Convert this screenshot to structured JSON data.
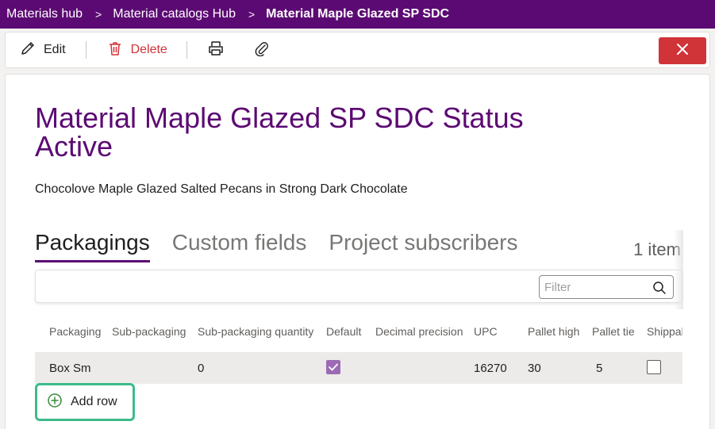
{
  "breadcrumb": {
    "items": [
      "Materials hub",
      "Material catalogs Hub",
      "Material Maple Glazed SP SDC"
    ],
    "separator": ">"
  },
  "toolbar": {
    "edit_label": "Edit",
    "delete_label": "Delete"
  },
  "header": {
    "title": "Material Maple Glazed SP SDC Status Active",
    "subtitle": "Chocolove Maple Glazed Salted Pecans in Strong Dark Chocolate"
  },
  "tabs": [
    {
      "label": "Packagings",
      "active": true
    },
    {
      "label": "Custom fields",
      "active": false
    },
    {
      "label": "Project subscribers",
      "active": false
    }
  ],
  "item_count": "1 item",
  "filter": {
    "placeholder": "Filter",
    "value": ""
  },
  "table": {
    "columns": [
      "Packaging",
      "Sub-packaging",
      "Sub-packaging quantity",
      "Default",
      "Decimal precision",
      "UPC",
      "Pallet high",
      "Pallet tie",
      "Shippable"
    ],
    "rows": [
      {
        "packaging": "Box Sm",
        "sub_packaging": "",
        "sub_packaging_quantity": "0",
        "default": true,
        "decimal_precision": "",
        "upc": "16270",
        "pallet_high": "30",
        "pallet_tie": "5",
        "shippable": false
      }
    ]
  },
  "add_row_label": "Add row",
  "colors": {
    "brand": "#5c0a73",
    "danger": "#d13438",
    "highlight": "#3dbb8a",
    "checkbox_on": "#9c6bb5"
  }
}
